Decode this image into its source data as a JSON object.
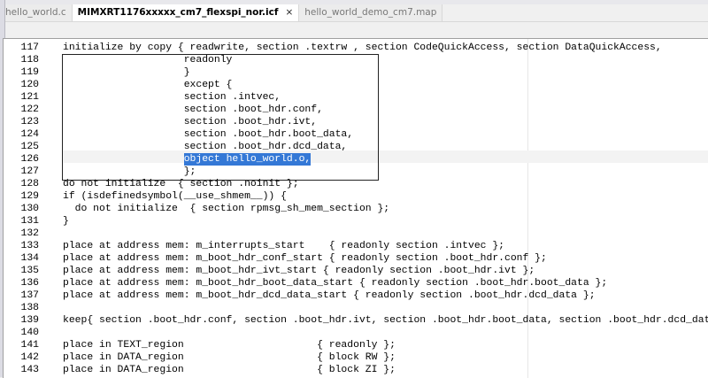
{
  "tabs": [
    {
      "label": "hello_world.c",
      "active": false
    },
    {
      "label": "MIMXRT1176xxxxx_cm7_flexspi_nor.icf",
      "active": true,
      "close": "×"
    },
    {
      "label": "hello_world_demo_cm7.map",
      "active": false
    }
  ],
  "editor": {
    "current_line": 126,
    "selection": {
      "line": 126,
      "text": "object hello_world.o,"
    },
    "lines": [
      {
        "n": "117",
        "t": "initialize by copy { readwrite, section .textrw , section CodeQuickAccess, section DataQuickAccess,"
      },
      {
        "n": "118",
        "t": "                    readonly"
      },
      {
        "n": "119",
        "t": "                    }"
      },
      {
        "n": "120",
        "t": "                    except {"
      },
      {
        "n": "121",
        "t": "                    section .intvec,"
      },
      {
        "n": "122",
        "t": "                    section .boot_hdr.conf,"
      },
      {
        "n": "123",
        "t": "                    section .boot_hdr.ivt,"
      },
      {
        "n": "124",
        "t": "                    section .boot_hdr.boot_data,"
      },
      {
        "n": "125",
        "t": "                    section .boot_hdr.dcd_data,"
      },
      {
        "n": "126",
        "t": "                    ",
        "sel": "object hello_world.o,"
      },
      {
        "n": "127",
        "t": "                    };"
      },
      {
        "n": "128",
        "t": "do not initialize  { section .noinit };"
      },
      {
        "n": "129",
        "t": "if (isdefinedsymbol(__use_shmem__)) {"
      },
      {
        "n": "130",
        "t": "  do not initialize  { section rpmsg_sh_mem_section };"
      },
      {
        "n": "131",
        "t": "}"
      },
      {
        "n": "132",
        "t": ""
      },
      {
        "n": "133",
        "t": "place at address mem: m_interrupts_start    { readonly section .intvec };"
      },
      {
        "n": "134",
        "t": "place at address mem: m_boot_hdr_conf_start { readonly section .boot_hdr.conf };"
      },
      {
        "n": "135",
        "t": "place at address mem: m_boot_hdr_ivt_start { readonly section .boot_hdr.ivt };"
      },
      {
        "n": "136",
        "t": "place at address mem: m_boot_hdr_boot_data_start { readonly section .boot_hdr.boot_data };"
      },
      {
        "n": "137",
        "t": "place at address mem: m_boot_hdr_dcd_data_start { readonly section .boot_hdr.dcd_data };"
      },
      {
        "n": "138",
        "t": ""
      },
      {
        "n": "139",
        "t": "keep{ section .boot_hdr.conf, section .boot_hdr.ivt, section .boot_hdr.boot_data, section .boot_hdr.dcd_data };"
      },
      {
        "n": "140",
        "t": ""
      },
      {
        "n": "141",
        "t": "place in TEXT_region                      { readonly };"
      },
      {
        "n": "142",
        "t": "place in DATA_region                      { block RW };"
      },
      {
        "n": "143",
        "t": "place in DATA_region                      { block ZI };"
      }
    ]
  }
}
